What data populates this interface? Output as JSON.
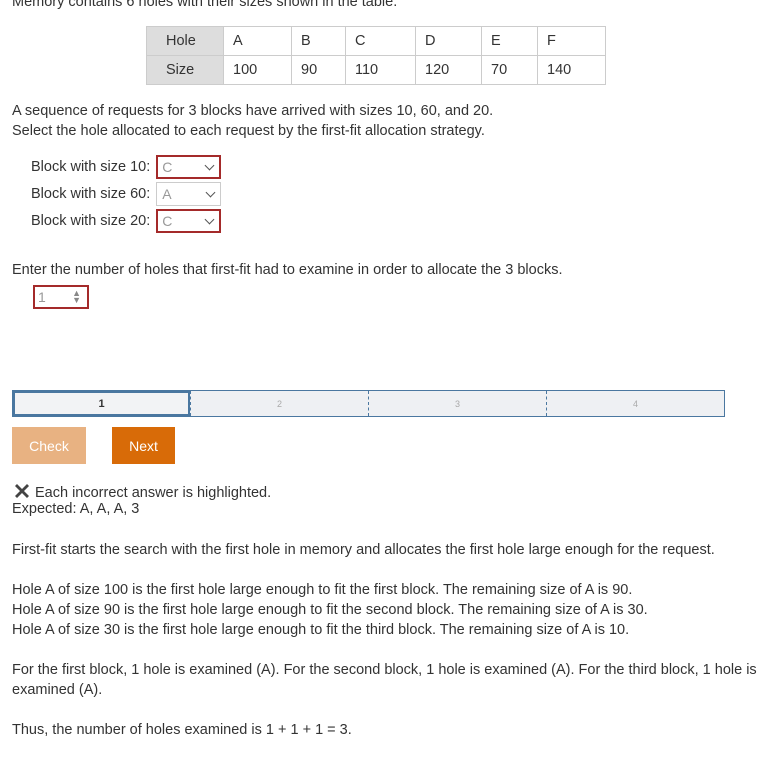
{
  "intro": "Memory contains 6 holes with their sizes shown in the table.",
  "table": {
    "row_labels": [
      "Hole",
      "Size"
    ],
    "holes": [
      "A",
      "B",
      "C",
      "D",
      "E",
      "F"
    ],
    "sizes": [
      "100",
      "90",
      "110",
      "120",
      "70",
      "140"
    ]
  },
  "prompt_line1": "A sequence of requests for 3 blocks have arrived with sizes 10, 60, and 20.",
  "prompt_line2": "Select the hole allocated to each request by the first-fit allocation strategy.",
  "selects": [
    {
      "label": "Block with size 10:",
      "value": "C",
      "incorrect": true
    },
    {
      "label": "Block with size 60:",
      "value": "A",
      "incorrect": false
    },
    {
      "label": "Block with size 20:",
      "value": "C",
      "incorrect": true
    }
  ],
  "count_prompt": "Enter the number of holes that first-fit had to examine in order to allocate the 3 blocks.",
  "count_value": "1",
  "progress": {
    "steps": [
      "1",
      "2",
      "3",
      "4"
    ],
    "current": "1"
  },
  "buttons": {
    "check": "Check",
    "next": "Next"
  },
  "feedback": {
    "icon": "x-mark-icon",
    "message": "Each incorrect answer is highlighted.",
    "expected": "Expected: A, A, A, 3"
  },
  "explanation": {
    "p1": "First-fit starts the search with the first hole in memory and allocates the first hole large enough for the request.",
    "p2": [
      "Hole A of size 100 is the first hole large enough to fit the first block. The remaining size of A is 90.",
      "Hole A of size 90 is the first hole large enough to fit the second block. The remaining size of A is 30.",
      "Hole A of size 30 is the first hole large enough to fit the third block. The remaining size of A is 10."
    ],
    "p3a": "For the first block, 1 hole is examined (A). For the second block, 1 hole is examined (A). For the third block, 1 hole is",
    "p3b": "examined (A).",
    "p4": "Thus, the number of holes examined is 1 + 1 + 1 = 3."
  },
  "colors": {
    "incorrect": "#a42a2a",
    "accent": "#d86b08",
    "accent_disabled": "#e8b282",
    "progress_border": "#4a77a0"
  }
}
